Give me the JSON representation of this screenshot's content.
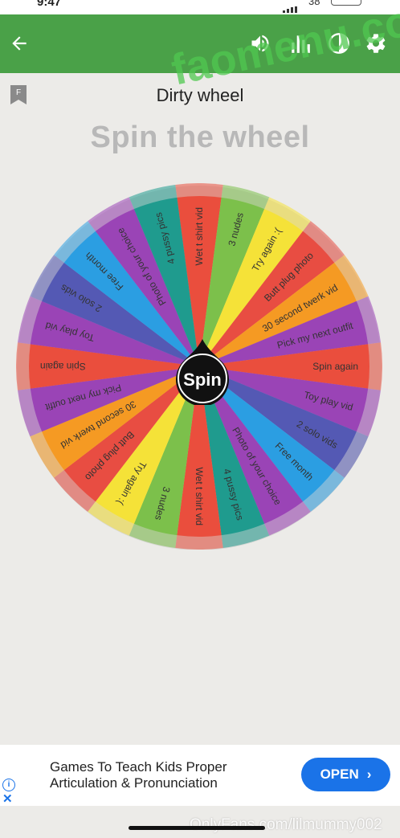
{
  "status_bar": {
    "time": "9:47",
    "battery": "38"
  },
  "app_bar": {
    "back_icon": "arrow-left",
    "icons": [
      "volume-icon",
      "stats-icon",
      "theme-icon",
      "gear-icon"
    ],
    "color": "#4aa148"
  },
  "wheel_title": "Dirty wheel",
  "heading": "Spin the wheel",
  "flag_label": "F",
  "watermark": "faomenu.com",
  "spin_label": "Spin",
  "segments": [
    {
      "label": "Wet t shirt vid",
      "color": "#ea4e3d"
    },
    {
      "label": "3 nudes",
      "color": "#7cc04b"
    },
    {
      "label": "Try again :(",
      "color": "#f5e238"
    },
    {
      "label": "Butt plug photo",
      "color": "#e84d42"
    },
    {
      "label": "30 second twerk vid",
      "color": "#f59a23"
    },
    {
      "label": "Pick my next outfit",
      "color": "#9a44b6"
    },
    {
      "label": "Spin again",
      "color": "#ea4e3d"
    },
    {
      "label": "Toy play vid",
      "color": "#9a44b6"
    },
    {
      "label": "2 solo vids",
      "color": "#5459b4"
    },
    {
      "label": "Free month",
      "color": "#2b9ee2"
    },
    {
      "label": "Photo of your choice",
      "color": "#9a44b6"
    },
    {
      "label": "4 pussy pics",
      "color": "#1f9b8e"
    },
    {
      "label": "Wet t shirt vid",
      "color": "#ea4e3d"
    },
    {
      "label": "3 nudes",
      "color": "#7cc04b"
    },
    {
      "label": "Try again :(",
      "color": "#f5e238"
    },
    {
      "label": "Butt plug photo",
      "color": "#e84d42"
    },
    {
      "label": "30 second twerk vid",
      "color": "#f59a23"
    },
    {
      "label": "Pick my next outfit",
      "color": "#9a44b6"
    },
    {
      "label": "Spin again",
      "color": "#ea4e3d"
    },
    {
      "label": "Toy play vid",
      "color": "#9a44b6"
    },
    {
      "label": "2 solo vids",
      "color": "#5459b4"
    },
    {
      "label": "Free month",
      "color": "#2b9ee2"
    },
    {
      "label": "Photo of your choice",
      "color": "#9a44b6"
    },
    {
      "label": "4 pussy pics",
      "color": "#1f9b8e"
    }
  ],
  "ad": {
    "text": "Games To Teach Kids Proper Articulation & Pronunciation",
    "open_label": "OPEN",
    "info_icon": "info-icon",
    "close_icon": "close-icon"
  },
  "footer_watermark": "OnlyFans.com/lilmummy002"
}
